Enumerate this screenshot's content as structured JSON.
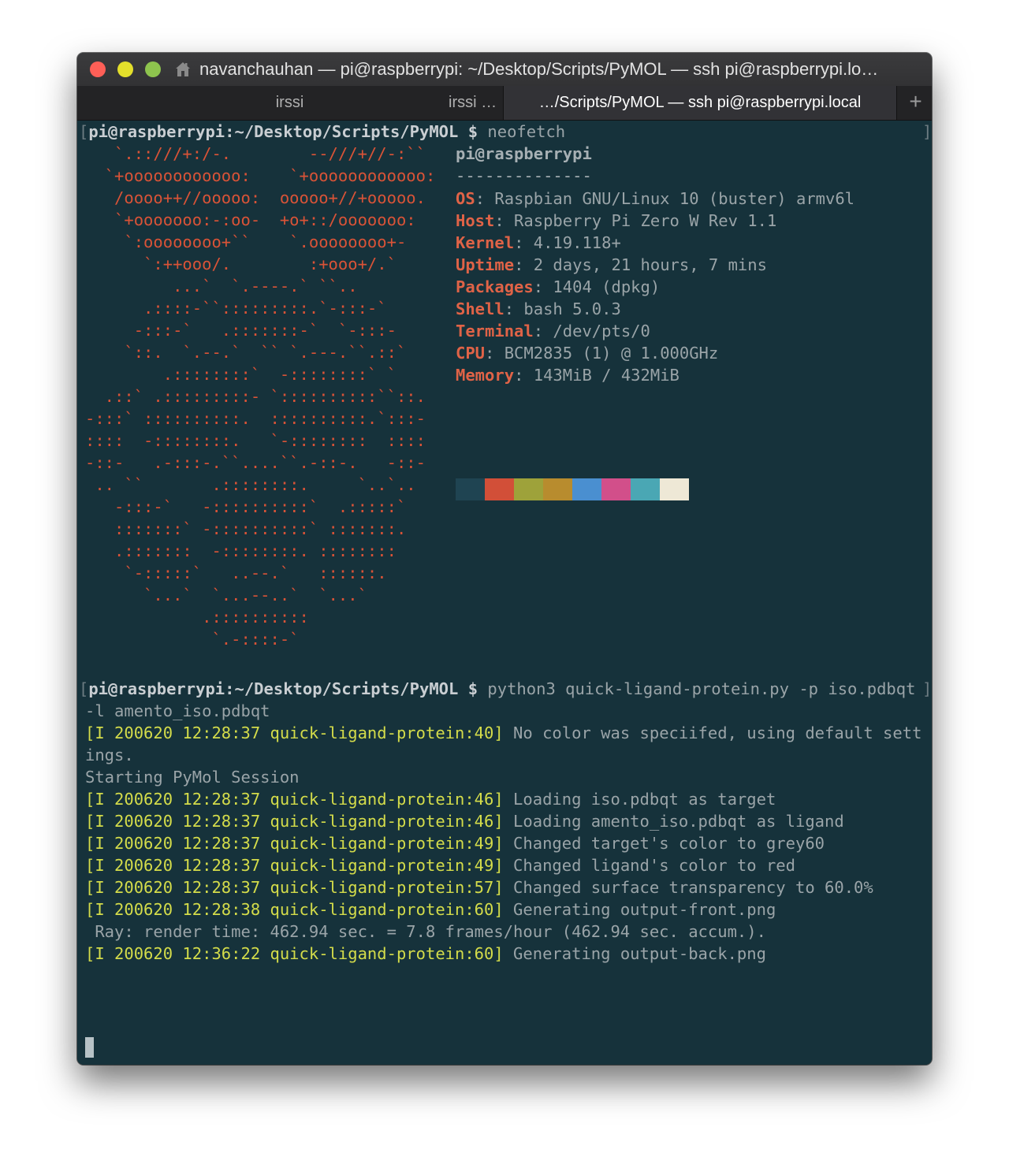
{
  "window": {
    "title": "navanchauhan — pi@raspberrypi: ~/Desktop/Scripts/PyMOL — ssh pi@raspberrypi.lo…"
  },
  "tabs": [
    {
      "label": "irssi"
    },
    {
      "label": "irssi …"
    },
    {
      "label": "…/Scripts/PyMOL — ssh pi@raspberrypi.local"
    }
  ],
  "new_tab": "+",
  "terminal": {
    "prompt_1": {
      "bracket": "[",
      "host": "pi@raspberrypi",
      "path": ":~/Desktop/Scripts/PyMOL",
      "dollar": " $ ",
      "command": "neofetch"
    },
    "ascii_art": [
      "   `.::///+:/-.        --///+//-:``",
      "  `+oooooooooooo:    `+oooooooooooo:",
      "   /oooo++//ooooo:  ooooo+//+ooooo.",
      "   `+ooooooo:-:oo-  +o+::/ooooooo:",
      "    `:oooooooo+``    `.oooooooo+-",
      "      `:++ooo/.        :+ooo+/.`",
      "         ...`  `.----.` ``..",
      "      .::::-``:::::::::.`-:::-`",
      "     -:::-`   .:::::::-`  `-:::-",
      "    `::.  `.--.`  `` `.---.``.::`",
      "        .::::::::`  -::::::::` `",
      "  .::` .:::::::::- `::::::::::``::.",
      "-:::` ::::::::::.  ::::::::::.`:::-",
      "::::  -::::::::.   `-::::::::  ::::",
      "-::-   .-:::-.``....``.-::-.   -::-",
      " .. ``       .::::::::.     `..`..",
      "   -:::-`   -::::::::::`  .:::::`",
      "   :::::::` -::::::::::` :::::::.",
      "   .:::::::  -::::::::. ::::::::",
      "    `-:::::`   ..--.`   ::::::.",
      "      `...`  `...--..`  `...`",
      "            .::::::::::",
      "             `.-::::-`"
    ],
    "info": {
      "user": "pi@raspberrypi",
      "separator": "--------------",
      "rows": [
        {
          "key": "OS",
          "value": ": Raspbian GNU/Linux 10 (buster) armv6l"
        },
        {
          "key": "Host",
          "value": ": Raspberry Pi Zero W Rev 1.1"
        },
        {
          "key": "Kernel",
          "value": ": 4.19.118+"
        },
        {
          "key": "Uptime",
          "value": ": 2 days, 21 hours, 7 mins"
        },
        {
          "key": "Packages",
          "value": ": 1404 (dpkg)"
        },
        {
          "key": "Shell",
          "value": ": bash 5.0.3"
        },
        {
          "key": "Terminal",
          "value": ": /dev/pts/0"
        },
        {
          "key": "CPU",
          "value": ": BCM2835 (1) @ 1.000GHz"
        },
        {
          "key": "Memory",
          "value": ": 143MiB / 432MiB"
        }
      ],
      "palette": [
        "#1f4452",
        "#d24f38",
        "#9ea23a",
        "#b88c2e",
        "#4a8fd0",
        "#d24f8a",
        "#4aa7b4",
        "#eee8d6"
      ]
    },
    "prompt_2": {
      "bracket": "[",
      "host": "pi@raspberrypi",
      "path": ":~/Desktop/Scripts/PyMOL",
      "dollar": " $ ",
      "command": "python3 quick-ligand-protein.py -p iso.pdbqt",
      "command_cont": "-l amento_iso.pdbqt"
    },
    "right_bracket": "]",
    "output": [
      {
        "tag": "[I 200620 12:28:37 quick-ligand-protein:40]",
        "msg": " No color was speciifed, using default sett"
      },
      {
        "tag": "",
        "msg": "ings."
      },
      {
        "tag": "",
        "msg": "Starting PyMol Session"
      },
      {
        "tag": "[I 200620 12:28:37 quick-ligand-protein:46]",
        "msg": " Loading iso.pdbqt as target"
      },
      {
        "tag": "[I 200620 12:28:37 quick-ligand-protein:46]",
        "msg": " Loading amento_iso.pdbqt as ligand"
      },
      {
        "tag": "[I 200620 12:28:37 quick-ligand-protein:49]",
        "msg": " Changed target's color to grey60"
      },
      {
        "tag": "[I 200620 12:28:37 quick-ligand-protein:49]",
        "msg": " Changed ligand's color to red"
      },
      {
        "tag": "[I 200620 12:28:37 quick-ligand-protein:57]",
        "msg": " Changed surface transparency to 60.0%"
      },
      {
        "tag": "[I 200620 12:28:38 quick-ligand-protein:60]",
        "msg": " Generating output-front.png"
      },
      {
        "tag": "",
        "msg": " Ray: render time: 462.94 sec. = 7.8 frames/hour (462.94 sec. accum.)."
      },
      {
        "tag": "[I 200620 12:36:22 quick-ligand-protein:60]",
        "msg": " Generating output-back.png"
      }
    ]
  }
}
